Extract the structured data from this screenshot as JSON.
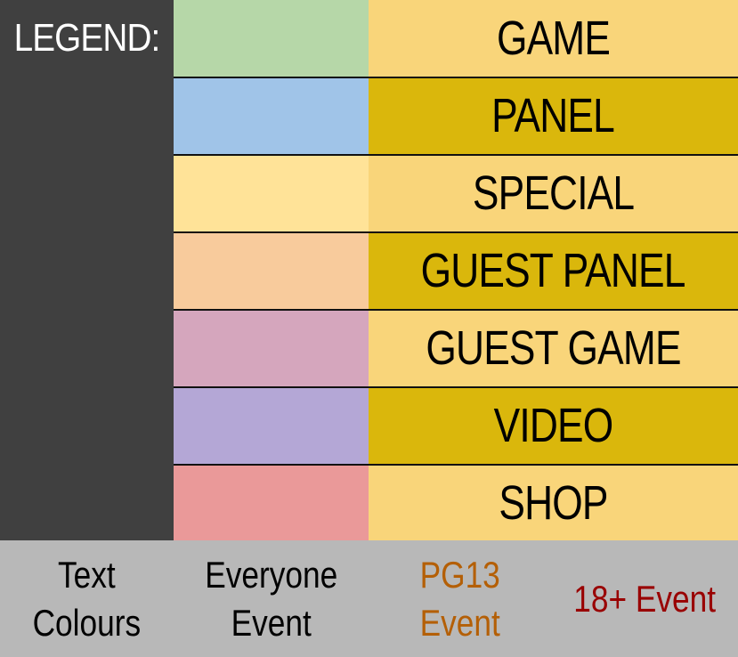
{
  "legend": {
    "title": "LEGEND:",
    "colors": {
      "panel_background": "#404040",
      "title_text": "#ffffff",
      "divider": "#111111"
    }
  },
  "categories": [
    {
      "label": "GAME",
      "swatch_color": "#b6d7a8",
      "label_bg": "#f9d57a"
    },
    {
      "label": "PANEL",
      "swatch_color": "#a0c4e8",
      "label_bg": "#dab70c"
    },
    {
      "label": "SPECIAL",
      "swatch_color": "#ffe398",
      "label_bg": "#f9d57a"
    },
    {
      "label": "GUEST PANEL",
      "swatch_color": "#f8cb9c",
      "label_bg": "#dab70c"
    },
    {
      "label": "GUEST GAME",
      "swatch_color": "#d5a6bd",
      "label_bg": "#f9d57a"
    },
    {
      "label": "VIDEO",
      "swatch_color": "#b4a7d6",
      "label_bg": "#dab70c"
    },
    {
      "label": "SHOP",
      "swatch_color": "#ea9999",
      "label_bg": "#f9d57a"
    }
  ],
  "footer": {
    "background": "#b8b8b8",
    "items": [
      {
        "text": "Text\nColours",
        "color": "#000000"
      },
      {
        "text": "Everyone\nEvent",
        "color": "#000000"
      },
      {
        "text": "PG13\nEvent",
        "color": "#b45f06"
      },
      {
        "text": "18+ Event",
        "color": "#990000"
      }
    ]
  }
}
